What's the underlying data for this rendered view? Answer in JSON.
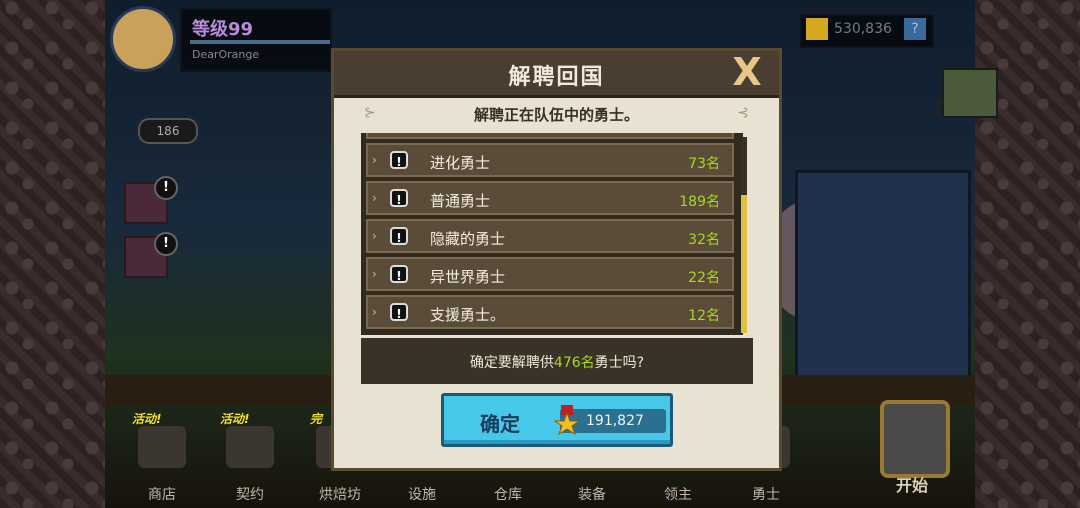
{
  "profile": {
    "level": "等级99",
    "username": "DearOrange"
  },
  "currency": {
    "amount": "530,836",
    "help": "?"
  },
  "mail_count": "186",
  "side_badges": [
    "!",
    "!"
  ],
  "bottom_menu": [
    {
      "label": "商店",
      "tag": "活动!"
    },
    {
      "label": "契约",
      "tag": "活动!"
    },
    {
      "label": "烘焙坊",
      "tag": "完"
    },
    {
      "label": "设施",
      "tag": ""
    },
    {
      "label": "仓库",
      "tag": ""
    },
    {
      "label": "装备",
      "tag": ""
    },
    {
      "label": "领主",
      "tag": ""
    },
    {
      "label": "勇士",
      "tag": ""
    }
  ],
  "start_label": "开始",
  "modal": {
    "title": "解聘回国",
    "close": "X",
    "subtitle": "解聘正在队伍中的勇士。",
    "rows": [
      {
        "name": "进化勇士",
        "count": "73名",
        "icon": "!"
      },
      {
        "name": "普通勇士",
        "count": "189名",
        "icon": "!"
      },
      {
        "name": "隐藏的勇士",
        "count": "32名",
        "icon": "!"
      },
      {
        "name": "异世界勇士",
        "count": "22名",
        "icon": "!"
      },
      {
        "name": "支援勇士。",
        "count": "12名",
        "icon": "!"
      }
    ],
    "confirm_pre": "确定要解聘供",
    "confirm_num": "476名",
    "confirm_post": "勇士吗?",
    "ok_label": "确定",
    "cost": "191,827"
  },
  "colors": {
    "accent_green": "#a8d820",
    "button_blue": "#48c8e8",
    "modal_bg": "#e8e2d2"
  }
}
